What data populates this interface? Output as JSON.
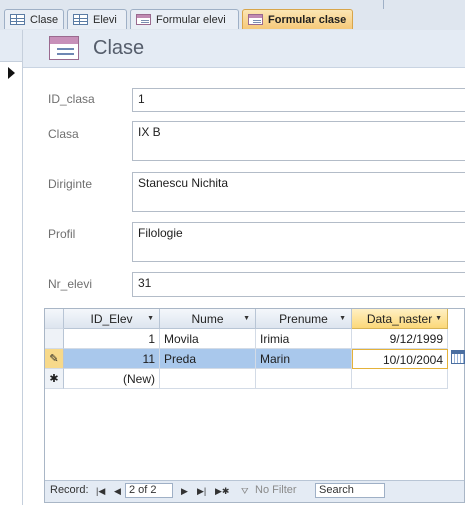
{
  "tabs": [
    {
      "label": "Clase",
      "icon": "table-icon"
    },
    {
      "label": "Elevi",
      "icon": "table-icon"
    },
    {
      "label": "Formular elevi",
      "icon": "form-icon"
    },
    {
      "label": "Formular clase",
      "icon": "form-icon",
      "active": true
    }
  ],
  "form": {
    "title": "Clase",
    "fields": [
      {
        "label": "ID_clasa",
        "value": "1"
      },
      {
        "label": "Clasa",
        "value": "IX B"
      },
      {
        "label": "Diriginte",
        "value": "Stanescu Nichita"
      },
      {
        "label": "Profil",
        "value": "Filologie"
      },
      {
        "label": "Nr_elevi",
        "value": "31"
      }
    ]
  },
  "subform": {
    "columns": [
      "ID_Elev",
      "Nume",
      "Prenume",
      "Data_naster"
    ],
    "rows": [
      {
        "id": "1",
        "nume": "Movila",
        "prenume": "Irimia",
        "data": "9/12/1999"
      },
      {
        "id": "11",
        "nume": "Preda",
        "prenume": "Marin",
        "data": "10/10/2004"
      }
    ],
    "new_row_label": "(New)",
    "nav": {
      "record_label": "Record:",
      "position": "2 of 2",
      "filter_label": "No Filter",
      "search_placeholder": "Search"
    }
  },
  "colors": {
    "active_tab": "#f6c979",
    "selected_row": "#a9c8ec",
    "header_bg": "#e4ebf4"
  }
}
